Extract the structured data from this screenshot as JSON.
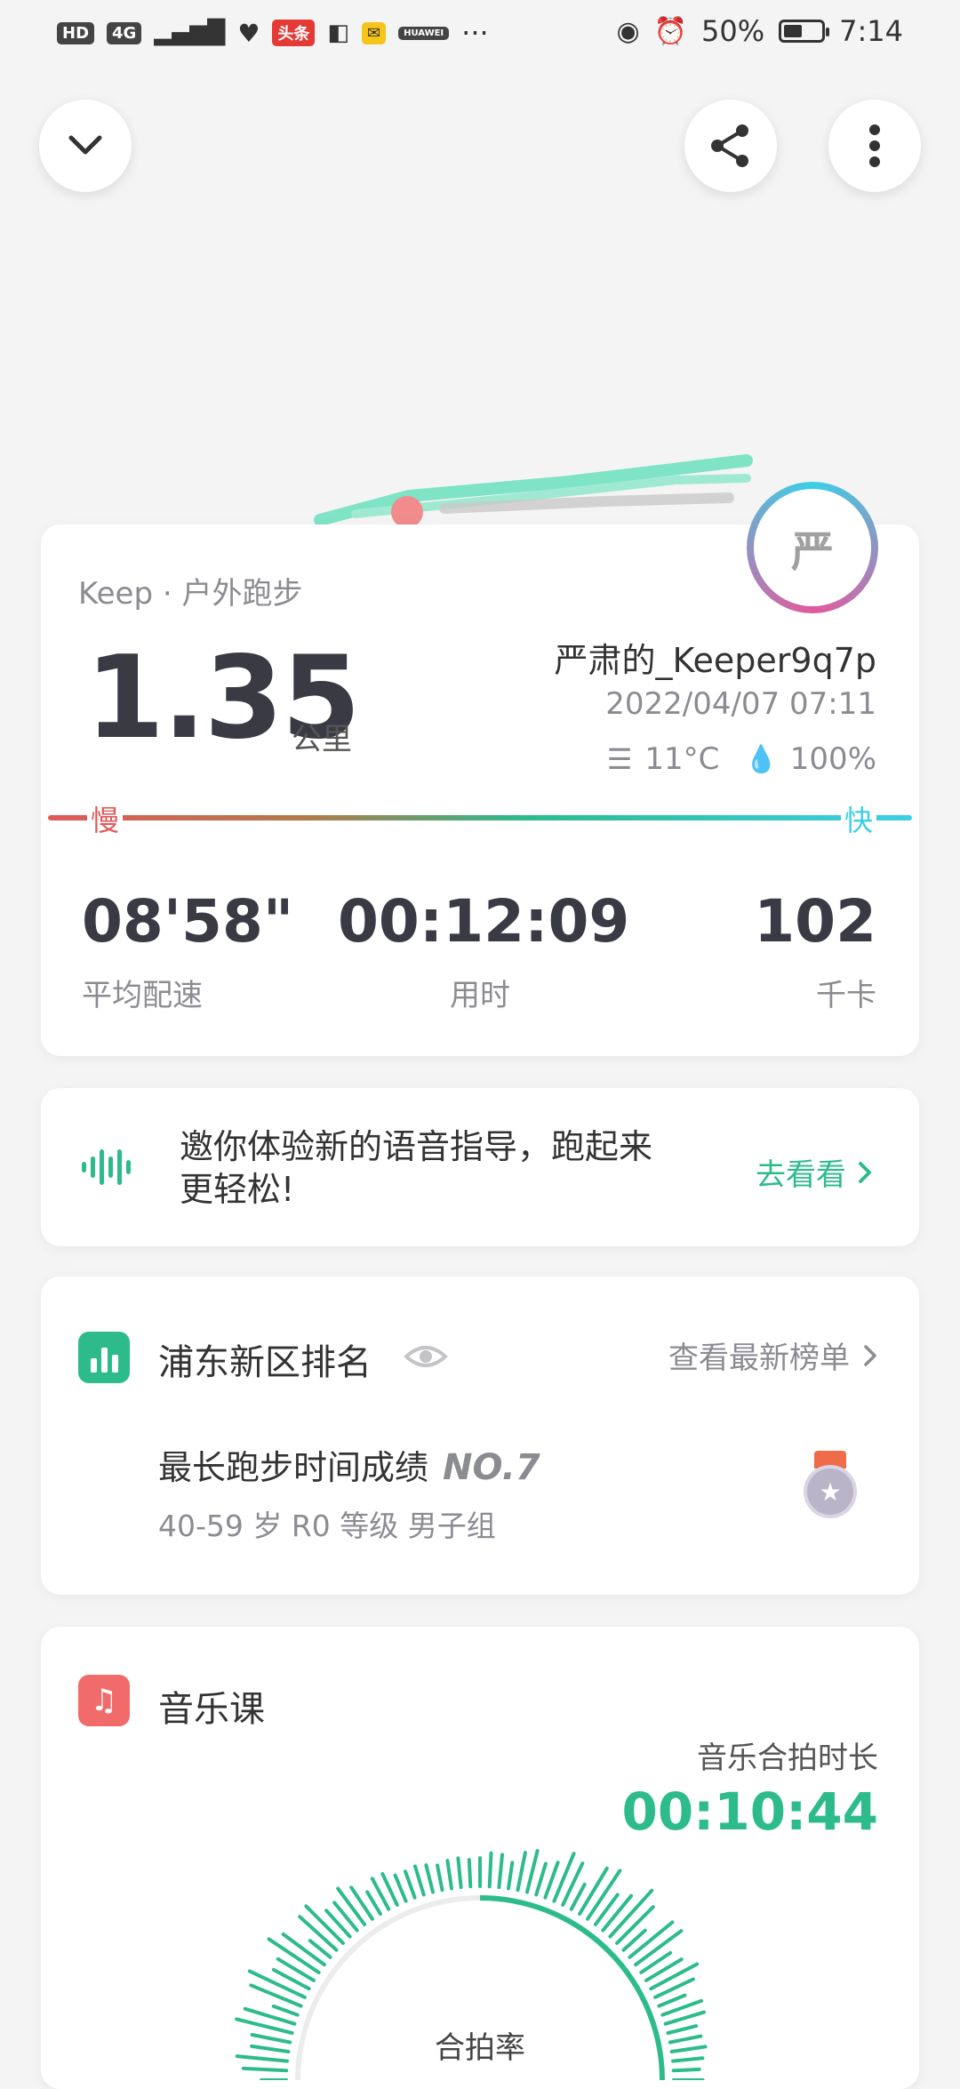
{
  "status_bar": {
    "chips": [
      "HD",
      "4G",
      "头条",
      "HUAWEI"
    ],
    "more": "···",
    "battery": "50%",
    "battery_level": 0.5,
    "time": "7:14"
  },
  "summary": {
    "source": "Keep · 户外跑步",
    "distance": "1.35",
    "distance_unit": "公里",
    "username": "严肃的_Keeper9q7p",
    "datetime": "2022/04/07 07:11",
    "temperature": "11°C",
    "humidity": "100%",
    "avatar_char": "严",
    "pace_slow_label": "慢",
    "pace_fast_label": "快",
    "stats": [
      {
        "value": "08'58\"",
        "label": "平均配速"
      },
      {
        "value": "00:12:09",
        "label": "用时"
      },
      {
        "value": "102",
        "label": "千卡"
      }
    ]
  },
  "voice_banner": {
    "text": "邀你体验新的语音指导，跑起来更轻松!",
    "line1": "邀你体验新的语音指导，跑起来",
    "line2": "更轻松!",
    "action": "去看看"
  },
  "ranking": {
    "title": "浦东新区排名",
    "link": "查看最新榜单",
    "item_title": "最长跑步时间成绩",
    "item_rank": "NO.7",
    "item_sub": "40-59 岁 R0 等级 男子组"
  },
  "music": {
    "title": "音乐课",
    "duration_label": "音乐合拍时长",
    "duration": "00:10:44",
    "rate_label": "合拍率"
  },
  "colors": {
    "accent": "#2dbb8c",
    "slow": "#e05a5a",
    "fast": "#3ccfe6",
    "text": "#3a3a44"
  }
}
